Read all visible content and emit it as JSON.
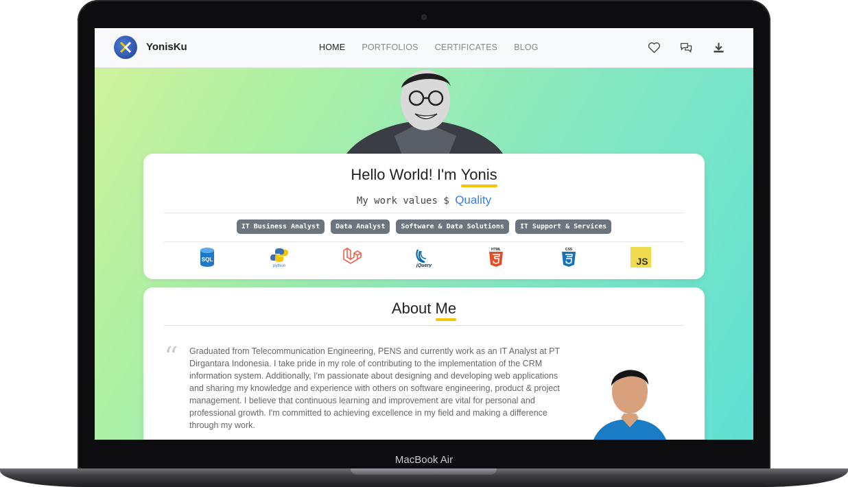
{
  "device_label": "MacBook Air",
  "nav": {
    "brand": "YonisKu",
    "menu": [
      "HOME",
      "PORTFOLIOS",
      "CERTIFICATES",
      "BLOG"
    ],
    "icons": [
      "heart-icon",
      "chat-icon",
      "download-icon"
    ]
  },
  "hero": {
    "greeting": "Hello World! I'm ",
    "name": "Yonis",
    "values_prefix": "My work values $ ",
    "values_word": "Quality",
    "roles": [
      "IT Business Analyst",
      "Data Analyst",
      "Software & Data Solutions",
      "IT Support & Services"
    ],
    "tech_icons": [
      {
        "icon": "sql-icon",
        "label": "SQL"
      },
      {
        "icon": "python-icon",
        "label": "python"
      },
      {
        "icon": "laravel-icon",
        "label": ""
      },
      {
        "icon": "jquery-icon",
        "label": "jQuery"
      },
      {
        "icon": "html5-icon",
        "label": "HTML"
      },
      {
        "icon": "css3-icon",
        "label": "CSS"
      },
      {
        "icon": "javascript-icon",
        "label": "JS"
      }
    ]
  },
  "about": {
    "title_plain": "About ",
    "title_highlight": "Me",
    "text": "Graduated from Telecommunication Engineering, PENS and currently work as an IT Analyst at PT Dirgantara Indonesia. I take pride in my role of contributing to the implementation of the CRM information system. Additionally, I'm passionate about designing and developing web applications and sharing my knowledge and experience with others on software engineering, product & project management. I believe that continuous learning and improvement are vital for personal and professional growth. I'm committed to achieving excellence in my field and making a difference through my work."
  },
  "colors": {
    "accent_underline": "#f5c400",
    "link_blue": "#3a7de0",
    "badge_gray": "#6c757d"
  }
}
